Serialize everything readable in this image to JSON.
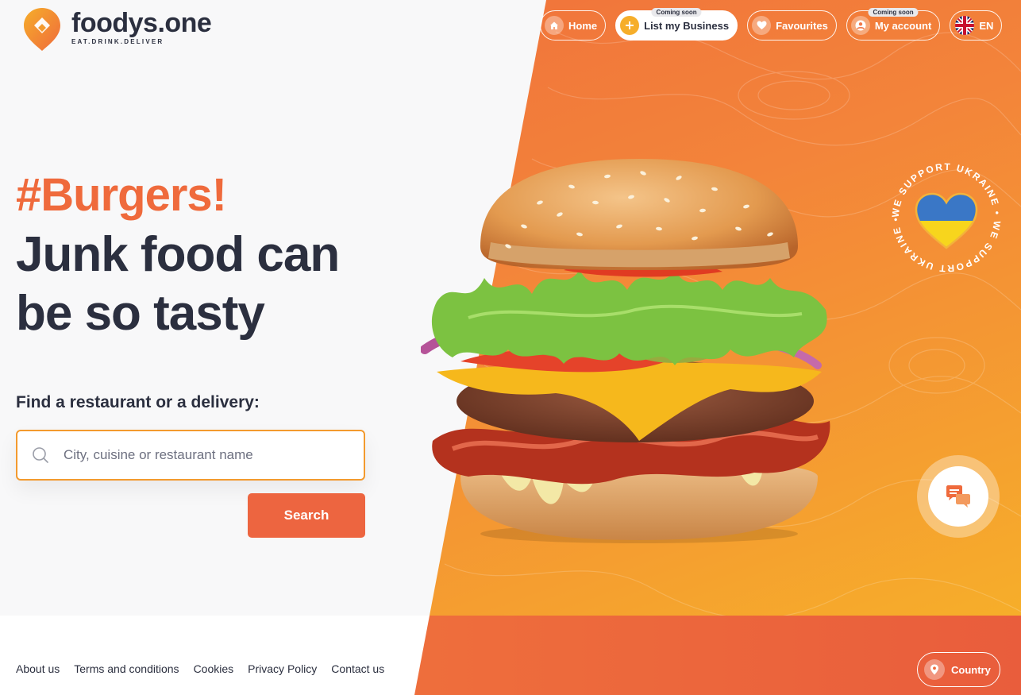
{
  "brand": {
    "name": "foodys.one",
    "tagline": "EAT.DRINK.DELIVER"
  },
  "nav": {
    "home": "Home",
    "list_business": "List my Business",
    "list_business_badge": "Coming soon",
    "favourites": "Favourites",
    "account": "My account",
    "account_badge": "Coming soon",
    "language": "EN"
  },
  "hero": {
    "hashtag": "#Burgers!",
    "headline": "Junk food can be so tasty",
    "find_label": "Find a restaurant or a delivery:",
    "search_placeholder": "City, cuisine or restaurant name",
    "search_button": "Search"
  },
  "badge": {
    "text": "WE SUPPORT UKRAINE • WE SUPPORT UKRAINE •"
  },
  "footer": {
    "links": [
      "About us",
      "Terms and conditions",
      "Cookies",
      "Privacy Policy",
      "Contact us"
    ],
    "country_button": "Country"
  },
  "colors": {
    "accent": "#ef6a3c",
    "accent_yellow": "#f6ae2a",
    "text": "#2b2f3f",
    "search_border": "#f39a2e"
  }
}
